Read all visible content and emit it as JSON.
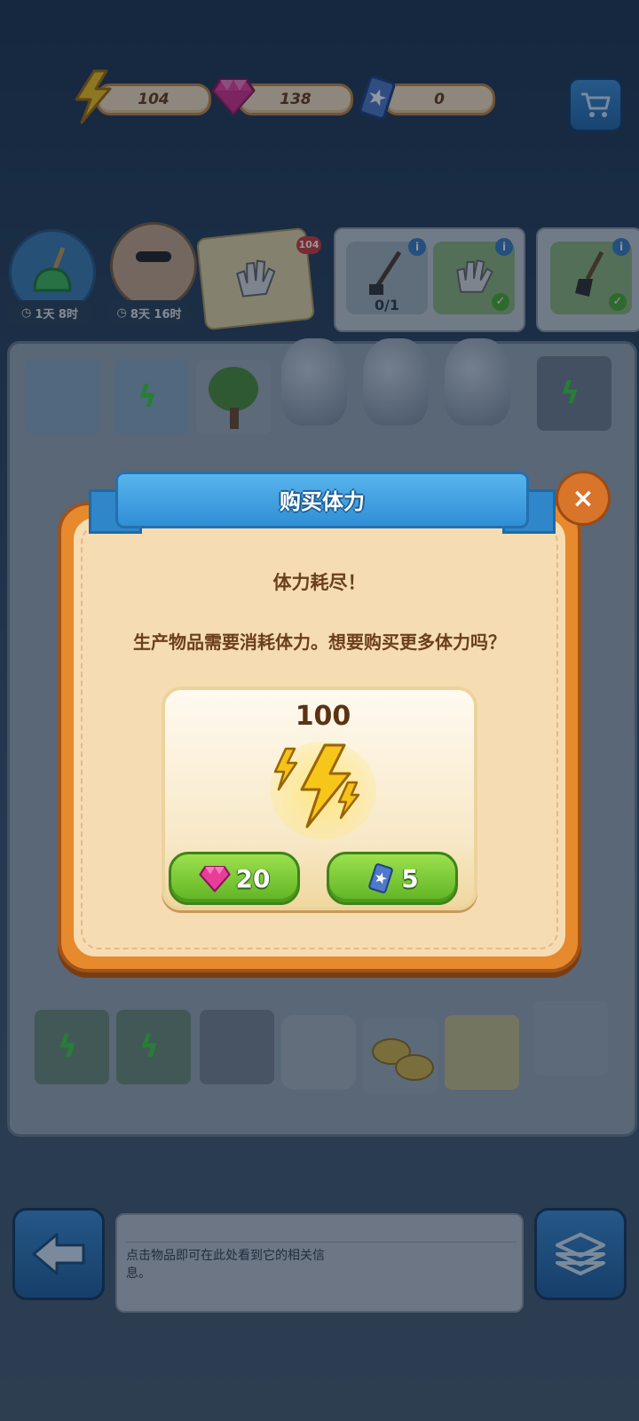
{
  "resources": {
    "energy": "104",
    "gems": "138",
    "cards": "0"
  },
  "timers": {
    "task1": "1天 8时",
    "task2": "8天 16时"
  },
  "badges": {
    "gloves_count": "104",
    "order_progress": "0/1"
  },
  "dialog": {
    "title": "购买体力",
    "heading": "体力耗尽！",
    "message": "生产物品需要消耗体力。想要购买更多体力吗？",
    "close_label": "×",
    "offer": {
      "amount": "100",
      "gem_price": "20",
      "card_price": "5"
    }
  },
  "info_panel": {
    "text": "点击物品即可在此处看到它的相关信息。"
  },
  "colors": {
    "accent_blue": "#2f8fd6",
    "dialog_orange": "#e7892d",
    "button_green": "#5fb323"
  }
}
